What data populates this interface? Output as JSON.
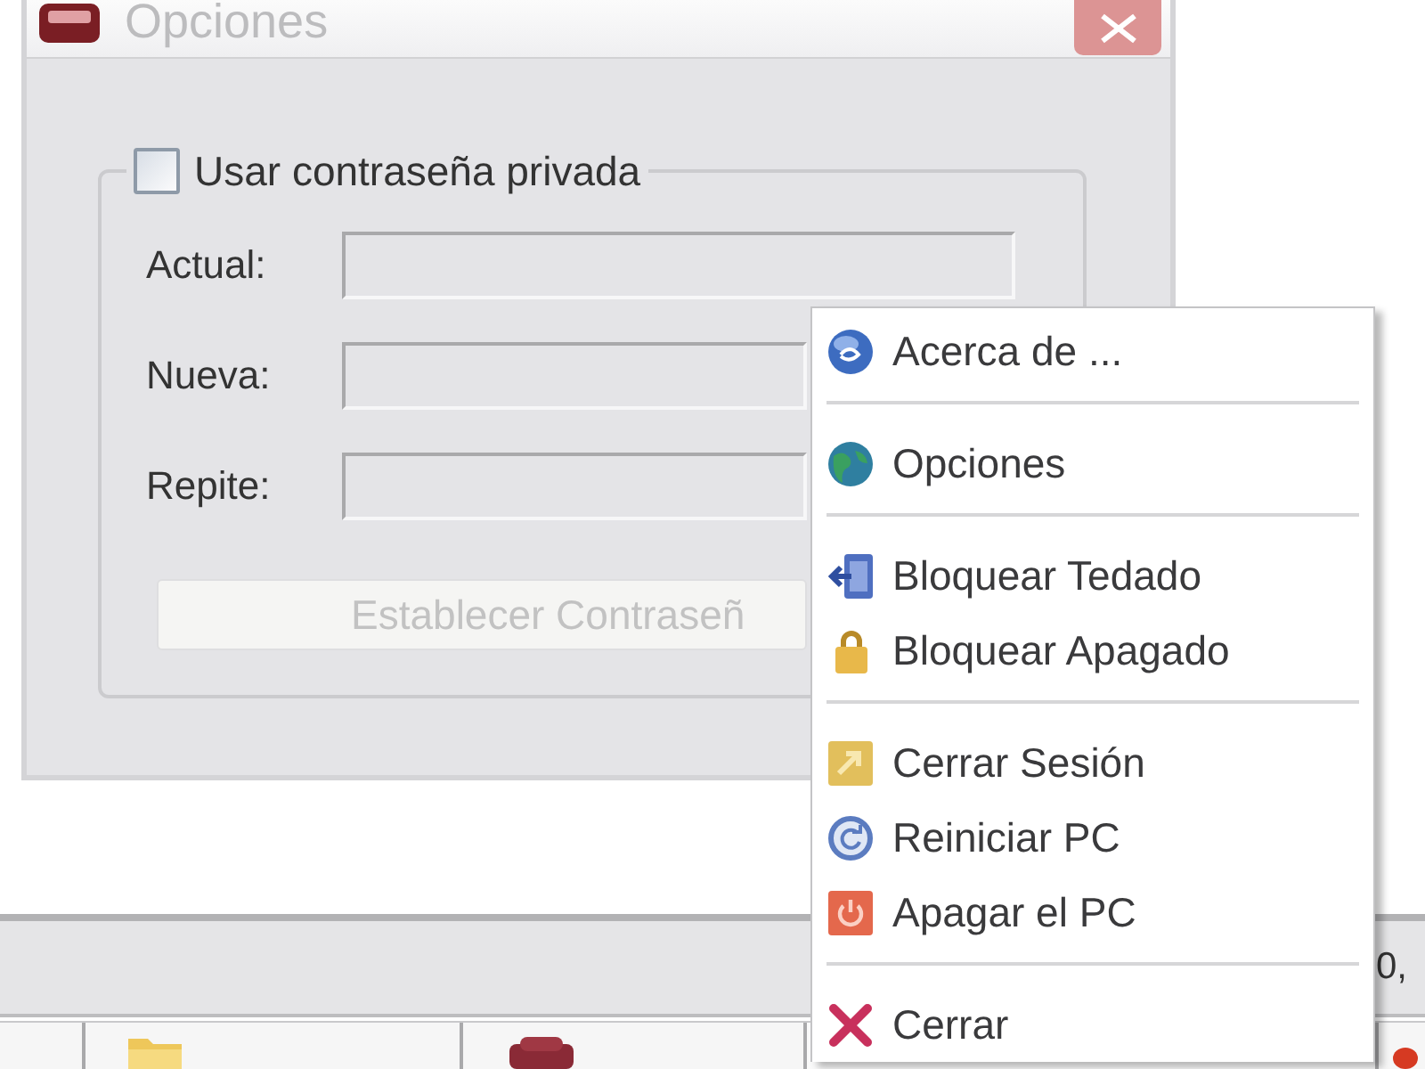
{
  "dialog": {
    "title": "Opciones",
    "active": false,
    "password_group": {
      "checkbox": {
        "label": "Usar contraseña privada",
        "checked": false
      },
      "fields": [
        {
          "label": "Actual:",
          "disabled": true
        },
        {
          "label": "Nueva:",
          "disabled": true
        },
        {
          "label": "Repite:",
          "disabled": true
        }
      ],
      "button": {
        "label": "Establecer Contraseñ",
        "disabled": true
      }
    }
  },
  "context_menu": {
    "groups": [
      {
        "items": [
          {
            "label": "Acerca de ...",
            "kind": "about"
          }
        ]
      },
      {
        "items": [
          {
            "label": "Opciones",
            "kind": "options"
          }
        ]
      },
      {
        "items": [
          {
            "label": "Bloquear Tedado",
            "kind": "keyboard"
          },
          {
            "label": "Bloquear Apagado",
            "kind": "lock"
          }
        ]
      },
      {
        "items": [
          {
            "label": "Cerrar Sesión",
            "kind": "logoff"
          },
          {
            "label": "Reiniciar PC",
            "kind": "restart"
          },
          {
            "label": "Apagar el PC",
            "kind": "shutdown"
          }
        ]
      },
      {
        "items": [
          {
            "label": "Cerrar",
            "kind": "exit"
          }
        ]
      }
    ]
  },
  "status_bar": {
    "text": "0,"
  },
  "taskbar": {
    "tabs": [
      {
        "kind": "plain"
      },
      {
        "kind": "folder"
      },
      {
        "kind": "box"
      },
      {
        "kind": "disc"
      }
    ]
  }
}
